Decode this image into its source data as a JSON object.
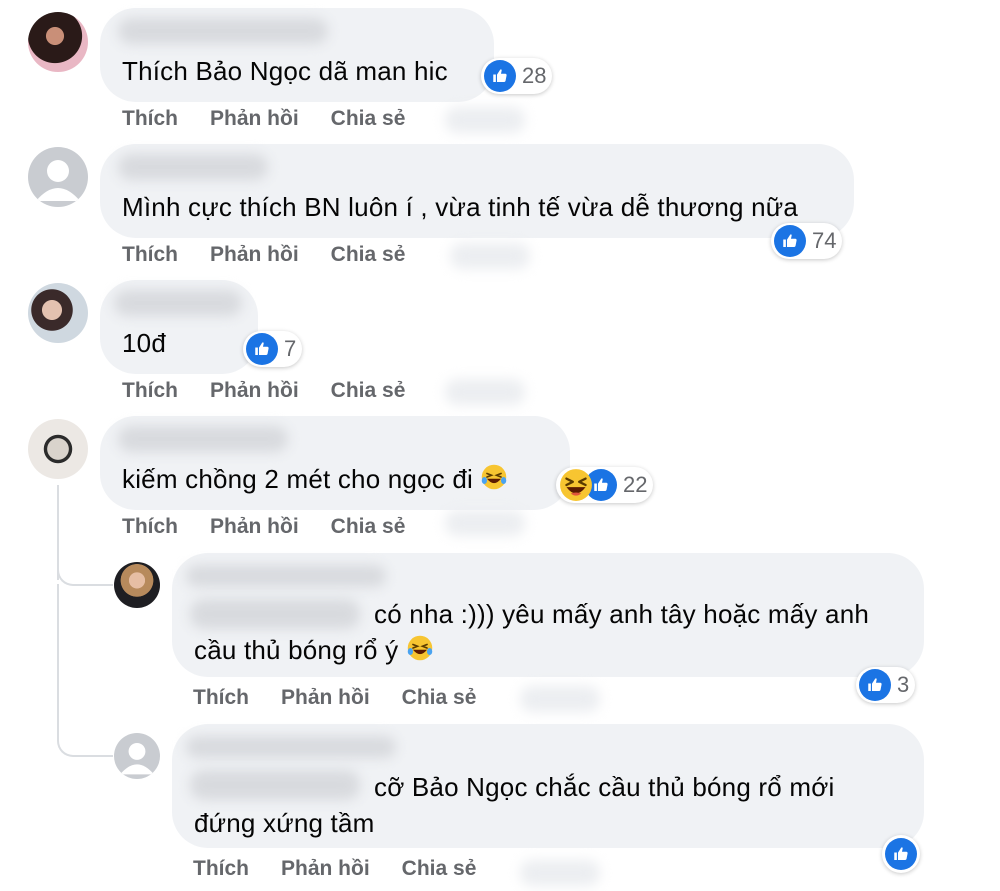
{
  "comments": [
    {
      "text": "Thích Bảo Ngọc dã man hic",
      "reaction_count": "28",
      "actions": {
        "like": "Thích",
        "reply": "Phản hồi",
        "share": "Chia sẻ"
      }
    },
    {
      "text": "Mình cực thích BN luôn í , vừa tinh tế vừa dễ thương nữa",
      "reaction_count": "74",
      "actions": {
        "like": "Thích",
        "reply": "Phản hồi",
        "share": "Chia sẻ"
      }
    },
    {
      "text": "10đ",
      "reaction_count": "7",
      "actions": {
        "like": "Thích",
        "reply": "Phản hồi",
        "share": "Chia sẻ"
      }
    },
    {
      "text": "kiếm chồng 2 mét cho ngọc đi",
      "reaction_count": "22",
      "actions": {
        "like": "Thích",
        "reply": "Phản hồi",
        "share": "Chia sẻ"
      }
    }
  ],
  "replies": [
    {
      "line1": "có nha :))) yêu mấy anh tây hoặc mấy anh",
      "line2": "cầu thủ bóng rổ ý",
      "reaction_count": "3",
      "actions": {
        "like": "Thích",
        "reply": "Phản hồi",
        "share": "Chia sẻ"
      }
    },
    {
      "line1": "cỡ Bảo Ngọc chắc cầu thủ bóng rổ mới",
      "line2": "đứng xứng tầm",
      "actions": {
        "like": "Thích",
        "reply": "Phản hồi",
        "share": "Chia sẻ"
      }
    }
  ],
  "colors": {
    "bubble": "#f0f2f5",
    "like_blue": "#1b74e4",
    "action_gray": "#65676b",
    "haha_yellow": "#f7c531"
  },
  "icons": [
    "like-icon",
    "haha-icon",
    "default-avatar-icon"
  ]
}
